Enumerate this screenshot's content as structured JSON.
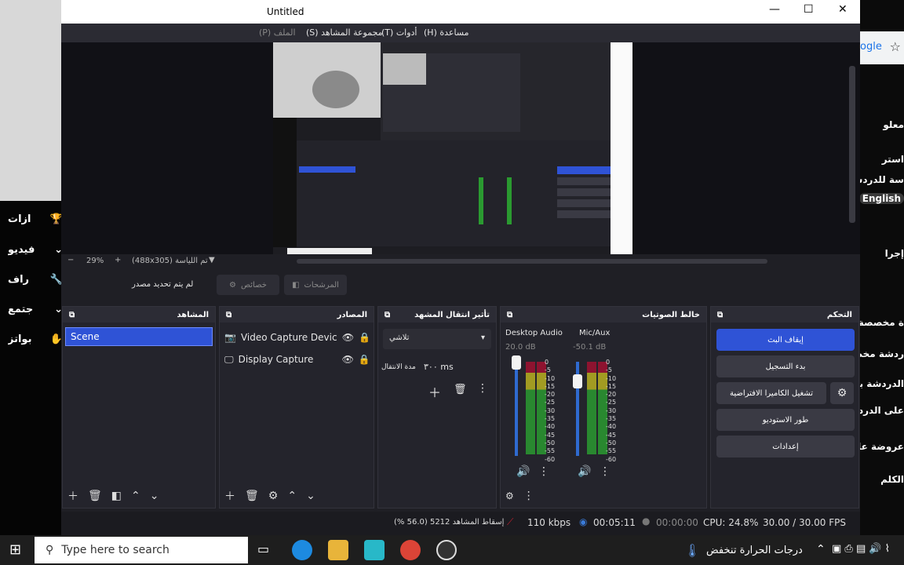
{
  "left_panel": {
    "items": [
      {
        "label": "ازات",
        "icon": "trophy-icon"
      },
      {
        "label": "فيديو",
        "icon": "chevron-down-icon"
      },
      {
        "label": "راف",
        "icon": "wrench-icon"
      },
      {
        "label": "جتمع",
        "icon": "chevron-down-icon"
      },
      {
        "label": "بواتز",
        "icon": "hand-icon"
      }
    ]
  },
  "obs": {
    "title": "Untitled",
    "window_controls": {
      "minimize": "—",
      "maximize": "☐",
      "close": "✕"
    },
    "menu": [
      "(H) مساعدة",
      "(T) أدوات",
      "(S) مجموعة المشاهد",
      "(P) الملف"
    ],
    "zoom": {
      "minus": "−",
      "value": "29%",
      "plus": "+",
      "scene_text": "(488x305) تم اللياسة"
    },
    "toolbar": {
      "no_source": "لم يتم تحديد مصدر",
      "properties": "خصائص",
      "filters": "المرشحات"
    },
    "docks": {
      "scenes": {
        "title": "المشاهد",
        "items": [
          "Scene"
        ]
      },
      "sources": {
        "title": "المصادر",
        "items": [
          "Video Capture Devic",
          "Display Capture"
        ]
      },
      "transitions": {
        "title": "تأثير انتقال المشهد",
        "selected": "تلاشي",
        "duration_label": "مدة الانتقال",
        "duration_value": "٣٠٠ ms"
      },
      "mixer": {
        "title": "خالط الصوتيات",
        "channels": [
          {
            "name": "Desktop Audio",
            "db": "20.0 dB",
            "level": 0.0
          },
          {
            "name": "Mic/Aux",
            "db": "-50.1 dB",
            "level": 0.2
          }
        ],
        "scale": [
          "0",
          "-5",
          "-10",
          "-15",
          "-20",
          "-25",
          "-30",
          "-35",
          "-40",
          "-45",
          "-50",
          "-55",
          "-60"
        ]
      },
      "controls": {
        "title": "التحكم",
        "buttons": [
          "إيقاف البث",
          "بدء التسجيل",
          "تشغيل الكاميرا الافتراضية",
          "طور الاستوديو",
          "إعدادات"
        ]
      }
    },
    "status": {
      "dropped": "إسقاط المشاهد 5212 (56.0 %)",
      "kbps": "110 kbps",
      "stream_time": "00:05:11",
      "rec_time": "00:00:00",
      "cpu": "CPU: 24.8%",
      "fps": "30.00 / 30.00 FPS"
    }
  },
  "right_strip": {
    "tab": "ogle",
    "lines": [
      "معلو",
      "استر",
      "سة للدردشة",
      "English",
      "إجرا",
      "ة مخصصة",
      "ردشة مخصص",
      "الدردشة بالـ",
      "على الدرد",
      "عروضة على",
      "الكلم"
    ]
  },
  "taskbar": {
    "search_placeholder": "Type here to search",
    "weather": "درجات الحرارة تنخفض",
    "colors": {
      "accent": "#2f53d6",
      "taskbar": "#1e1e1e"
    }
  }
}
